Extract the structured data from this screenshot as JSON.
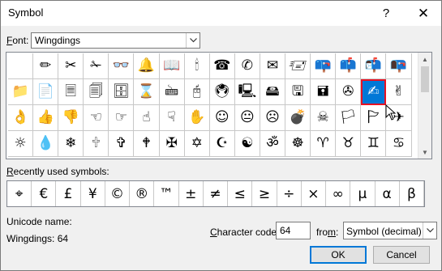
{
  "window": {
    "title": "Symbol",
    "help": "?",
    "close": "✕"
  },
  "font": {
    "label_u": "F",
    "label_rest": "ont:",
    "value": "Wingdings"
  },
  "symbols": [
    "",
    "✏",
    "✂",
    "✁",
    "👓",
    "🔔",
    "📖",
    "🕯",
    "☎",
    "✆",
    "✉",
    "🖅",
    "📪",
    "📫",
    "📬",
    "📭",
    "📁",
    "📄",
    "🗏",
    "🗐",
    "🗄",
    "⌛",
    "🖮",
    "🖰",
    "🖲",
    "🖳",
    "🖴",
    "🖫",
    "🖬",
    "✇",
    "✍",
    "✌",
    "👌",
    "👍",
    "👎",
    "☜",
    "☞",
    "☝",
    "☟",
    "✋",
    "☺",
    "😐",
    "☹",
    "💣",
    "☠",
    "🏳",
    "🏱",
    "✈",
    "☼",
    "💧",
    "❄",
    "🕆",
    "✞",
    "🕈",
    "✠",
    "✡",
    "☪",
    "☯",
    "ॐ",
    "☸",
    "♈",
    "♉",
    "♊",
    "♋",
    "♌",
    "♍"
  ],
  "selected_index": 30,
  "recent": {
    "label_pre": "",
    "label_u": "R",
    "label_rest": "ecently used symbols:",
    "items": [
      "⌖",
      "€",
      "£",
      "¥",
      "©",
      "®",
      "™",
      "±",
      "≠",
      "≤",
      "≥",
      "÷",
      "×",
      "∞",
      "µ",
      "α",
      "β"
    ]
  },
  "unicode": {
    "label": "Unicode name:",
    "value": "Wingdings: 64"
  },
  "char_code": {
    "label_u": "C",
    "label_rest": "haracter code:",
    "value": "64"
  },
  "from": {
    "label_pre": "fro",
    "label_u": "m",
    "label_rest": ":",
    "value": "Symbol (decimal)"
  },
  "buttons": {
    "ok": "OK",
    "cancel": "Cancel"
  }
}
